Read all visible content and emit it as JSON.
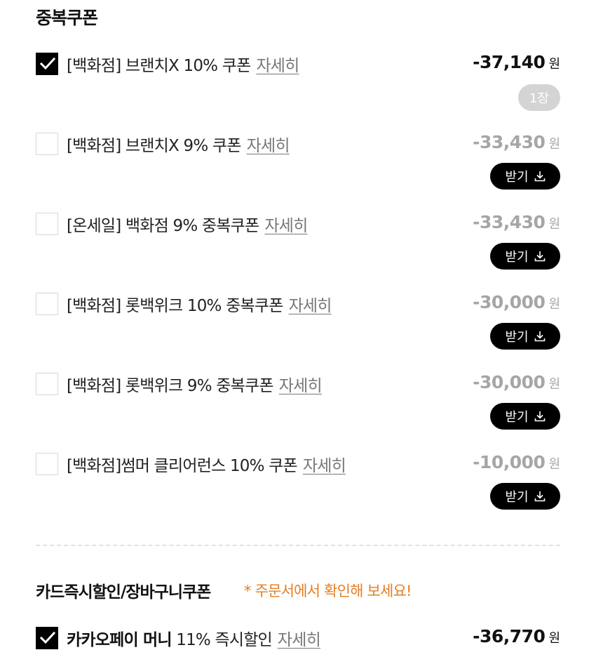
{
  "coupon_section": {
    "title": "중복쿠폰",
    "items": [
      {
        "label": "[백화점] 브랜치X 10% 쿠폰",
        "detail": "자세히",
        "amount": "-37,140",
        "unit": "원",
        "checked": true,
        "badge": "1장"
      },
      {
        "label": "[백화점] 브랜치X 9% 쿠폰",
        "detail": "자세히",
        "amount": "-33,430",
        "unit": "원",
        "checked": false,
        "button": "받기"
      },
      {
        "label": "[온세일] 백화점 9% 중복쿠폰",
        "detail": "자세히",
        "amount": "-33,430",
        "unit": "원",
        "checked": false,
        "button": "받기"
      },
      {
        "label": "[백화점] 롯백위크 10% 중복쿠폰",
        "detail": "자세히",
        "amount": "-30,000",
        "unit": "원",
        "checked": false,
        "button": "받기"
      },
      {
        "label": "[백화점] 롯백위크 9% 중복쿠폰",
        "detail": "자세히",
        "amount": "-30,000",
        "unit": "원",
        "checked": false,
        "button": "받기"
      },
      {
        "label": "[백화점]썸머 클리어런스 10% 쿠폰",
        "detail": "자세히",
        "amount": "-10,000",
        "unit": "원",
        "checked": false,
        "button": "받기"
      }
    ]
  },
  "card_section": {
    "title": "카드즉시할인/장바구니쿠폰",
    "notice": "* 주문서에서 확인해 보세요!",
    "items": [
      {
        "label_strong": "카카오페이 머니",
        "label_rest": " 11% 즉시할인",
        "detail": "자세히",
        "amount": "-36,770",
        "unit": "원",
        "checked": true
      }
    ]
  },
  "icons": {
    "check": "check-icon",
    "download": "download-icon"
  },
  "colors": {
    "notice": "#e67e22",
    "inactive_amount": "#a6a6a6",
    "button_bg": "#000000",
    "badge_bg": "#d4d4d4"
  }
}
